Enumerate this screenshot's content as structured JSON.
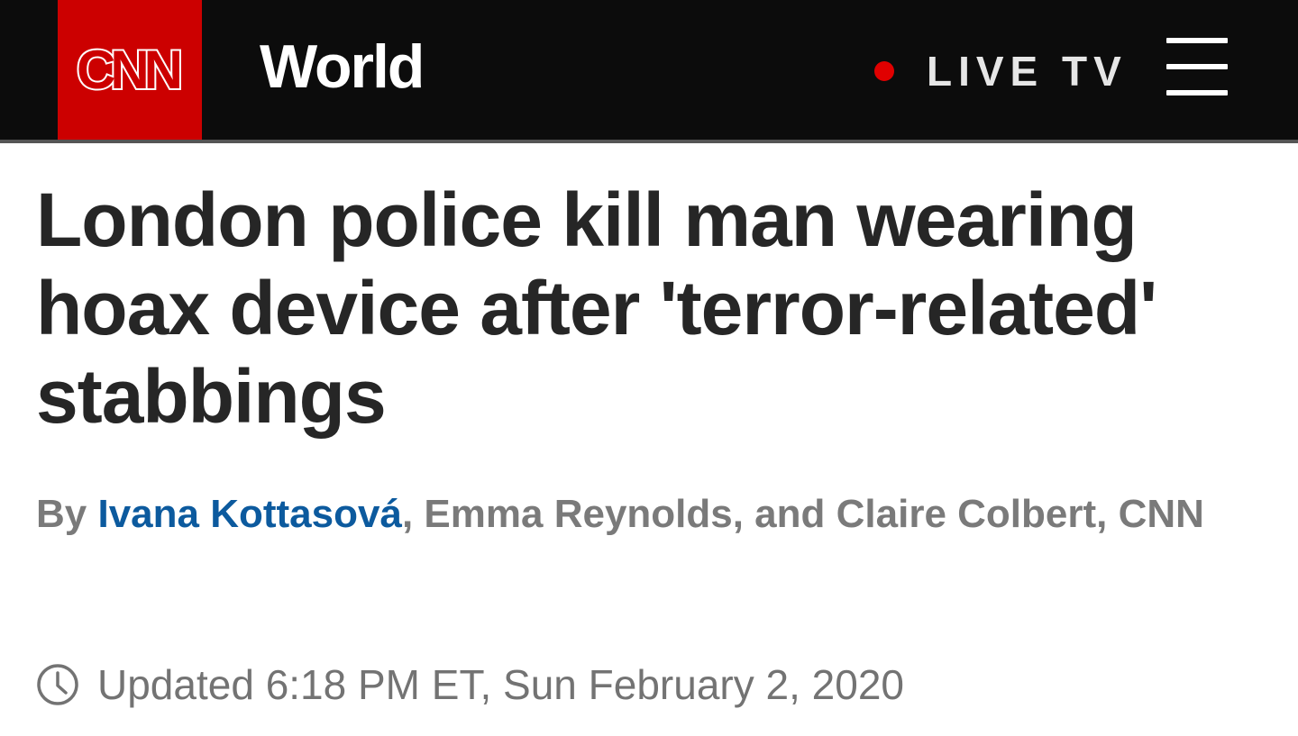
{
  "header": {
    "logo_text": "CNN",
    "section": "World",
    "live_label": "LIVE TV",
    "live_dot_color": "#e00000",
    "menu_icon": "hamburger-menu-icon",
    "brand_color": "#cc0000"
  },
  "article": {
    "headline": "London police kill man wearing hoax device after 'terror-related' stabbings",
    "byline": {
      "prefix": "By",
      "linked_author": "Ivana Kottasová",
      "rest": ", Emma Reynolds, and Claire Colbert, CNN"
    },
    "timestamp": "Updated 6:18 PM ET, Sun February 2, 2020",
    "timestamp_icon": "clock-icon",
    "link_color": "#0c5a9e"
  }
}
